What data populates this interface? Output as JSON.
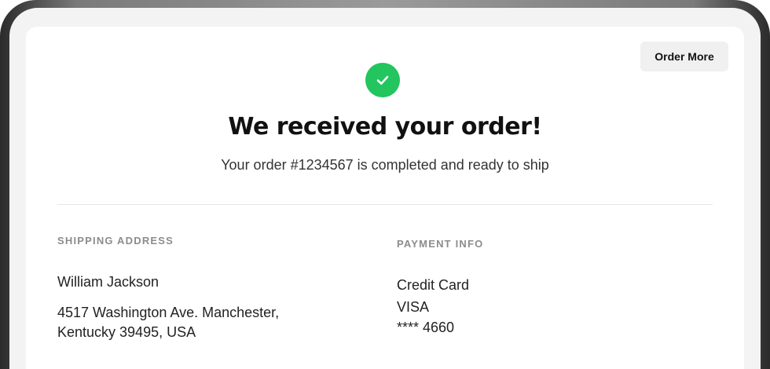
{
  "header": {
    "order_more_label": "Order More"
  },
  "confirmation": {
    "icon": "check-icon",
    "title": "We received your order!",
    "subtitle": "Your order #1234567 is completed and ready to ship"
  },
  "shipping": {
    "label": "SHIPPING ADDRESS",
    "name": "William Jackson",
    "address_line1": "4517 Washington Ave. Manchester,",
    "address_line2": "Kentucky 39495, USA"
  },
  "payment": {
    "label": "PAYMENT INFO",
    "method": "Credit Card",
    "brand": "VISA",
    "card_number": "**** 4660"
  },
  "colors": {
    "success": "#22c55e",
    "button_bg": "#f0f0f0",
    "label_gray": "#8c8c8c"
  }
}
